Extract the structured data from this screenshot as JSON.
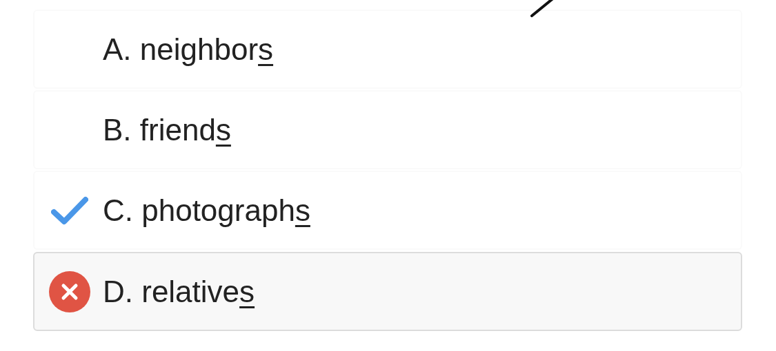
{
  "options": [
    {
      "letter": "A.",
      "word": "neighbor",
      "ending": "s",
      "kind": "plain",
      "selected": false
    },
    {
      "letter": "B.",
      "word": "friend",
      "ending": "s",
      "kind": "plain",
      "selected": false
    },
    {
      "letter": "C.",
      "word": "photograph",
      "ending": "s",
      "kind": "correct",
      "selected": false
    },
    {
      "letter": "D.",
      "word": "relative",
      "ending": "s",
      "kind": "wrong",
      "selected": true
    }
  ]
}
